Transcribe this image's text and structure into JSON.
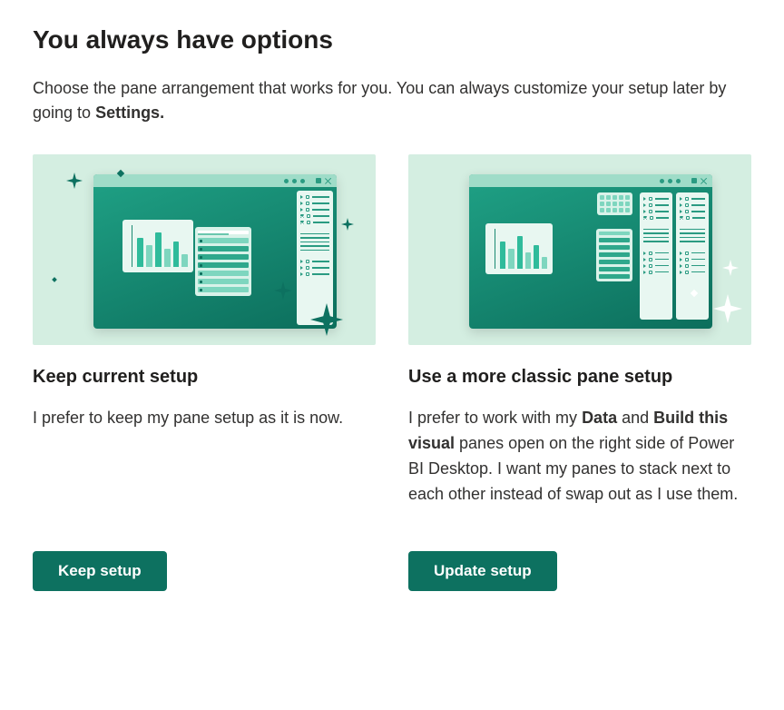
{
  "header": {
    "title": "You always have options",
    "desc_before": "Choose the pane arrangement that works for you. You can always customize your setup later by going to ",
    "desc_bold": "Settings."
  },
  "options": {
    "keep": {
      "title": "Keep current setup",
      "desc": "I prefer to keep my pane setup as it is now.",
      "button": "Keep setup"
    },
    "classic": {
      "title": "Use a more classic pane setup",
      "desc_parts": {
        "p1": "I prefer to work with my ",
        "b1": "Data",
        "p2": " and ",
        "b2": "Build this visual",
        "p3": " panes open on the right side of Power BI Desktop. I want my panes to stack next to each other instead of swap out as I use them."
      },
      "button": "Update setup"
    }
  },
  "colors": {
    "primary": "#0d7160",
    "illustration_bg": "#d4eee1"
  }
}
